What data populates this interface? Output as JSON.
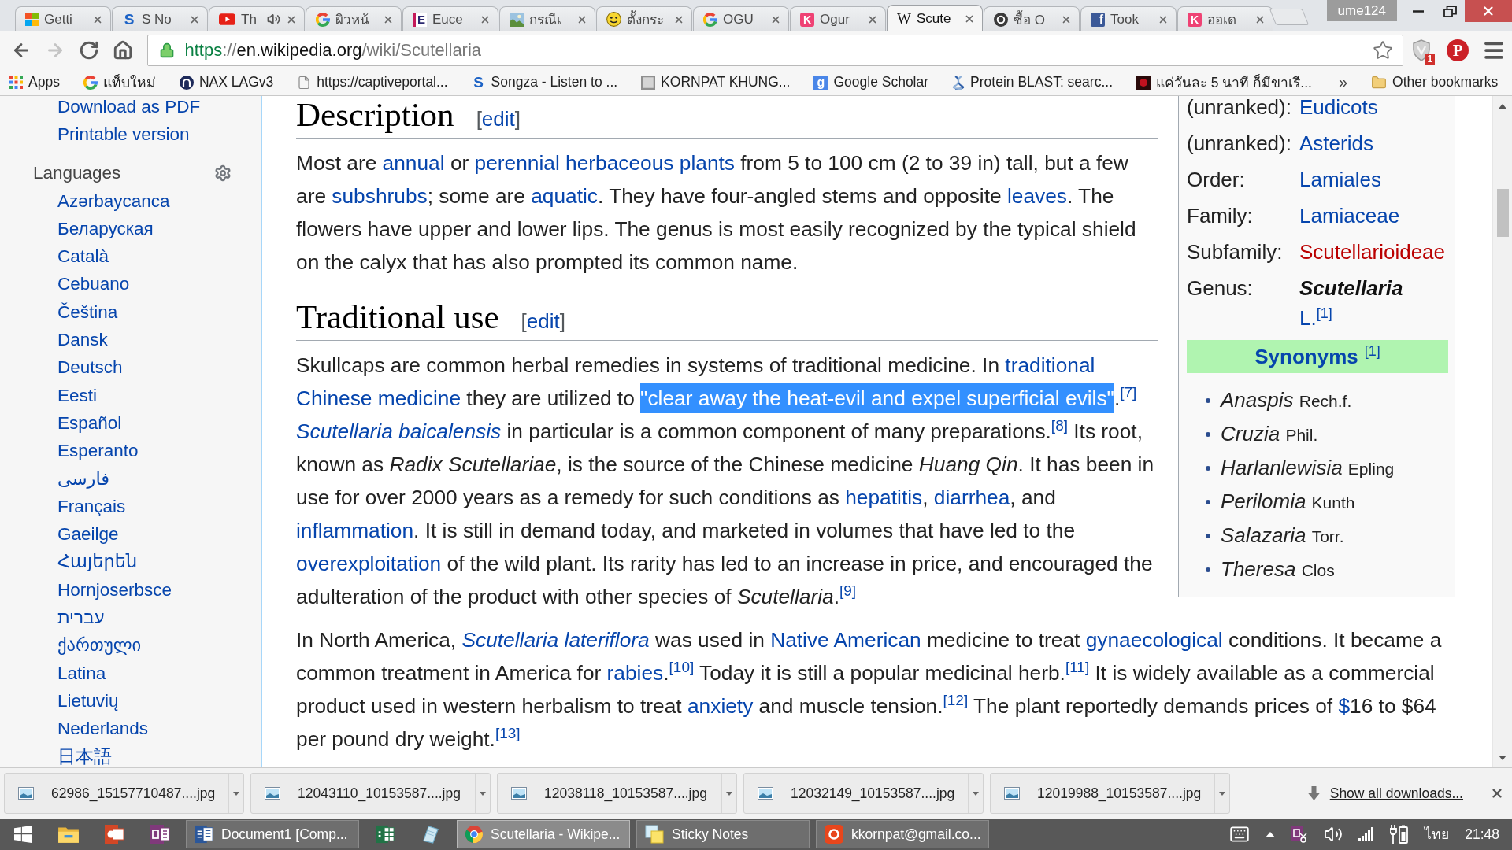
{
  "browser": {
    "tabs": [
      {
        "label": "Getti",
        "kind": "windows",
        "audio": false,
        "selected": false
      },
      {
        "label": "S No",
        "kind": "letter-s",
        "icon_text": "S",
        "audio": false,
        "selected": false
      },
      {
        "label": "Th",
        "kind": "youtube",
        "audio": true,
        "selected": false
      },
      {
        "label": "ผิวหน้",
        "kind": "google",
        "audio": false,
        "selected": false
      },
      {
        "label": "Euce",
        "kind": "letter-e",
        "icon_text": "E",
        "audio": false,
        "selected": false
      },
      {
        "label": "กรณีเ",
        "kind": "photo",
        "audio": false,
        "selected": false
      },
      {
        "label": "ตั้งกระ",
        "kind": "emoji",
        "audio": false,
        "selected": false
      },
      {
        "label": "OGU",
        "kind": "google",
        "audio": false,
        "selected": false
      },
      {
        "label": "Ogur",
        "kind": "letter-k",
        "icon_text": "K",
        "audio": false,
        "selected": false
      },
      {
        "label": "Scute",
        "kind": "letter-w",
        "icon_text": "W",
        "audio": false,
        "selected": true
      },
      {
        "label": "ซื้อ O",
        "kind": "dark-circle",
        "audio": false,
        "selected": false
      },
      {
        "label": "Took",
        "kind": "letter-f",
        "icon_text": "f",
        "audio": false,
        "selected": false
      },
      {
        "label": "ออเด",
        "kind": "letter-k",
        "icon_text": "K",
        "audio": false,
        "selected": false
      }
    ],
    "profile": "ume124",
    "nav": [
      {
        "kind": "back",
        "disabled": false
      },
      {
        "kind": "forward",
        "disabled": true
      },
      {
        "kind": "reload",
        "disabled": false
      },
      {
        "kind": "home",
        "disabled": false
      }
    ],
    "url": {
      "scheme": "https",
      "separator": "://",
      "host": "en.wikipedia.org",
      "path": "/wiki/Scutellaria"
    },
    "extensions": [
      {
        "kind": "shield",
        "badge": "1"
      },
      {
        "kind": "pin",
        "glyph": "P"
      }
    ],
    "bookmarks": [
      {
        "label": "Apps",
        "kind": "apps"
      },
      {
        "label": "แท็บใหม่",
        "kind": "google"
      },
      {
        "label": "NAX LAGv3",
        "kind": "arch"
      },
      {
        "label": "https://captiveportal...",
        "kind": "page"
      },
      {
        "label": "Songza - Listen to ...",
        "kind": "letter-s",
        "icon_text": "S"
      },
      {
        "label": "KORNPAT KHUNG...",
        "kind": "portrait"
      },
      {
        "label": "Google Scholar",
        "kind": "scholar",
        "icon_text": "g"
      },
      {
        "label": "Protein BLAST: searc...",
        "kind": "helix"
      },
      {
        "label": "แค่วันละ 5 นาที ก็มีขาเรี...",
        "kind": "dark-tile"
      }
    ],
    "overflow": "»",
    "other_bookmarks": "Other bookmarks"
  },
  "sidebar": {
    "tools": [
      "Download as PDF",
      "Printable version"
    ],
    "languages_heading": "Languages",
    "languages": [
      "Azərbaycanca",
      "Беларуская",
      "Català",
      "Cebuano",
      "Čeština",
      "Dansk",
      "Deutsch",
      "Eesti",
      "Español",
      "Esperanto",
      "فارسی",
      "Français",
      "Gaeilge",
      "Հայերեն",
      "Hornjoserbsce",
      "עברית",
      "ქართული",
      "Latina",
      "Lietuvių",
      "Nederlands",
      "日本語"
    ]
  },
  "article": {
    "blocks": [
      {
        "kind": "heading",
        "text": "Description",
        "edit": {
          "before": "[",
          "link": "edit",
          "after": "]"
        }
      },
      {
        "kind": "paragraph",
        "runs": [
          {
            "text": "Most are ",
            "kind": "plain"
          },
          {
            "text": "annual",
            "kind": "link"
          },
          {
            "text": " or ",
            "kind": "plain"
          },
          {
            "text": "perennial herbaceous plants",
            "kind": "link"
          },
          {
            "text": " from 5 to 100 cm (2 to 39 in) tall, but a few are ",
            "kind": "plain"
          },
          {
            "text": "subshrubs",
            "kind": "link"
          },
          {
            "text": "; some are ",
            "kind": "plain"
          },
          {
            "text": "aquatic",
            "kind": "link"
          },
          {
            "text": ". They have four-angled stems and opposite ",
            "kind": "plain"
          },
          {
            "text": "leaves",
            "kind": "link"
          },
          {
            "text": ". The flowers have upper and lower lips. The genus is most easily recognized by the typical shield on the calyx that has also prompted its common name.",
            "kind": "plain"
          }
        ]
      },
      {
        "kind": "heading",
        "text": "Traditional use",
        "edit": {
          "before": "[",
          "link": "edit",
          "after": "]"
        }
      },
      {
        "kind": "paragraph",
        "runs": [
          {
            "text": "Skullcaps are common herbal remedies in systems of traditional medicine. In ",
            "kind": "plain"
          },
          {
            "text": "traditional ",
            "kind": "link"
          },
          {
            "text": "Chinese medicine",
            "kind": "link"
          },
          {
            "text": " they are utilized to ",
            "kind": "plain"
          },
          {
            "text": "\"clear away the heat-evil and expel superficial evils\"",
            "kind": "selection"
          },
          {
            "text": ".",
            "kind": "plain"
          },
          {
            "text": "[7] ",
            "kind": "ref"
          },
          {
            "text": "Scutellaria baicalensis",
            "kind": "italic_link"
          },
          {
            "text": " in particular is a common component of many preparations.",
            "kind": "plain"
          },
          {
            "text": "[8]",
            "kind": "ref"
          },
          {
            "text": " Its root, known as ",
            "kind": "plain"
          },
          {
            "text": "Radix Scutellariae",
            "kind": "italic"
          },
          {
            "text": ", is the source of the Chinese medicine ",
            "kind": "plain"
          },
          {
            "text": "Huang Qin",
            "kind": "italic"
          },
          {
            "text": ". It has been in use for over 2000 years as a remedy for such conditions as ",
            "kind": "plain"
          },
          {
            "text": "hepatitis",
            "kind": "link"
          },
          {
            "text": ", ",
            "kind": "plain"
          },
          {
            "text": "diarrhea",
            "kind": "link"
          },
          {
            "text": ", and ",
            "kind": "plain"
          },
          {
            "text": "inflammation",
            "kind": "link"
          },
          {
            "text": ". It is still in demand today, and marketed in volumes that have led to the ",
            "kind": "plain"
          },
          {
            "text": "overexploitation",
            "kind": "link"
          },
          {
            "text": " of the wild plant. Its rarity has led to an increase in price, and encouraged the adulteration of the product with other species of ",
            "kind": "plain"
          },
          {
            "text": "Scutellaria",
            "kind": "italic"
          },
          {
            "text": ".",
            "kind": "plain"
          },
          {
            "text": "[9]",
            "kind": "ref"
          }
        ]
      },
      {
        "kind": "paragraph",
        "runs": [
          {
            "text": "In North America, ",
            "kind": "plain"
          },
          {
            "text": "Scutellaria lateriflora",
            "kind": "italic_link"
          },
          {
            "text": " was used in ",
            "kind": "plain"
          },
          {
            "text": "Native American",
            "kind": "link"
          },
          {
            "text": " medicine to treat ",
            "kind": "plain"
          },
          {
            "text": "gynaecological",
            "kind": "link"
          },
          {
            "text": " conditions. It became a common treatment in America for ",
            "kind": "plain"
          },
          {
            "text": "rabies",
            "kind": "link"
          },
          {
            "text": ".",
            "kind": "plain"
          },
          {
            "text": "[10]",
            "kind": "ref"
          },
          {
            "text": " Today it is still a popular medicinal herb.",
            "kind": "plain"
          },
          {
            "text": "[11]",
            "kind": "ref"
          },
          {
            "text": " It is widely available as a commercial product used in western herbalism to treat ",
            "kind": "plain"
          },
          {
            "text": "anxiety",
            "kind": "link"
          },
          {
            "text": " and muscle tension.",
            "kind": "plain"
          },
          {
            "text": "[12]",
            "kind": "ref"
          },
          {
            "text": " The plant reportedly demands prices of ",
            "kind": "plain"
          },
          {
            "text": "$",
            "kind": "link"
          },
          {
            "text": "16 to $64 per pound dry weight.",
            "kind": "plain"
          },
          {
            "text": "[13]",
            "kind": "ref"
          }
        ]
      }
    ]
  },
  "infobox": {
    "taxonomy": [
      {
        "rank": "(unranked):",
        "name": "Eudicots",
        "kind": "link"
      },
      {
        "rank": "(unranked):",
        "name": "Asterids",
        "kind": "link"
      },
      {
        "rank": "Order:",
        "name": "Lamiales",
        "kind": "link"
      },
      {
        "rank": "Family:",
        "name": "Lamiaceae",
        "kind": "link"
      },
      {
        "rank": "Subfamily:",
        "name": "Scutellarioideae",
        "kind": "redlink"
      },
      {
        "rank": "Genus:",
        "name": "Scutellaria",
        "kind": "genus",
        "authority": "L.",
        "ref": "[1]"
      }
    ],
    "synonyms_heading": "Synonyms",
    "synonyms_ref": "[1]",
    "synonyms": [
      {
        "name": "Anaspis",
        "author": "Rech.f."
      },
      {
        "name": "Cruzia",
        "author": "Phil."
      },
      {
        "name": "Harlanlewisia",
        "author": "Epling"
      },
      {
        "name": "Perilomia",
        "author": "Kunth"
      },
      {
        "name": "Salazaria",
        "author": "Torr."
      },
      {
        "name": "Theresa",
        "author": "Clos"
      }
    ]
  },
  "downloads": {
    "files": [
      "62986_15157710487....jpg",
      "12043110_10153587....jpg",
      "12038118_10153587....jpg",
      "12032149_10153587....jpg",
      "12019988_10153587....jpg"
    ],
    "show_all": "Show all downloads..."
  },
  "taskbar": {
    "apps": [
      {
        "kind": "start",
        "selected": false
      },
      {
        "kind": "explorer",
        "selected": false
      },
      {
        "kind": "powerpoint",
        "selected": false
      },
      {
        "kind": "onenote",
        "selected": false
      },
      {
        "kind": "word",
        "label": "Document1 [Comp...",
        "selected": false
      },
      {
        "kind": "excel",
        "selected": false
      },
      {
        "kind": "notepad",
        "selected": false
      },
      {
        "kind": "chrome",
        "label": "Scutellaria - Wikipe...",
        "selected": true
      },
      {
        "kind": "sticky",
        "label": "Sticky Notes",
        "selected": false
      },
      {
        "kind": "mail",
        "label": "kkornpat@gmail.co...",
        "selected": false
      }
    ],
    "language": "ไทย",
    "time": "21:48"
  }
}
